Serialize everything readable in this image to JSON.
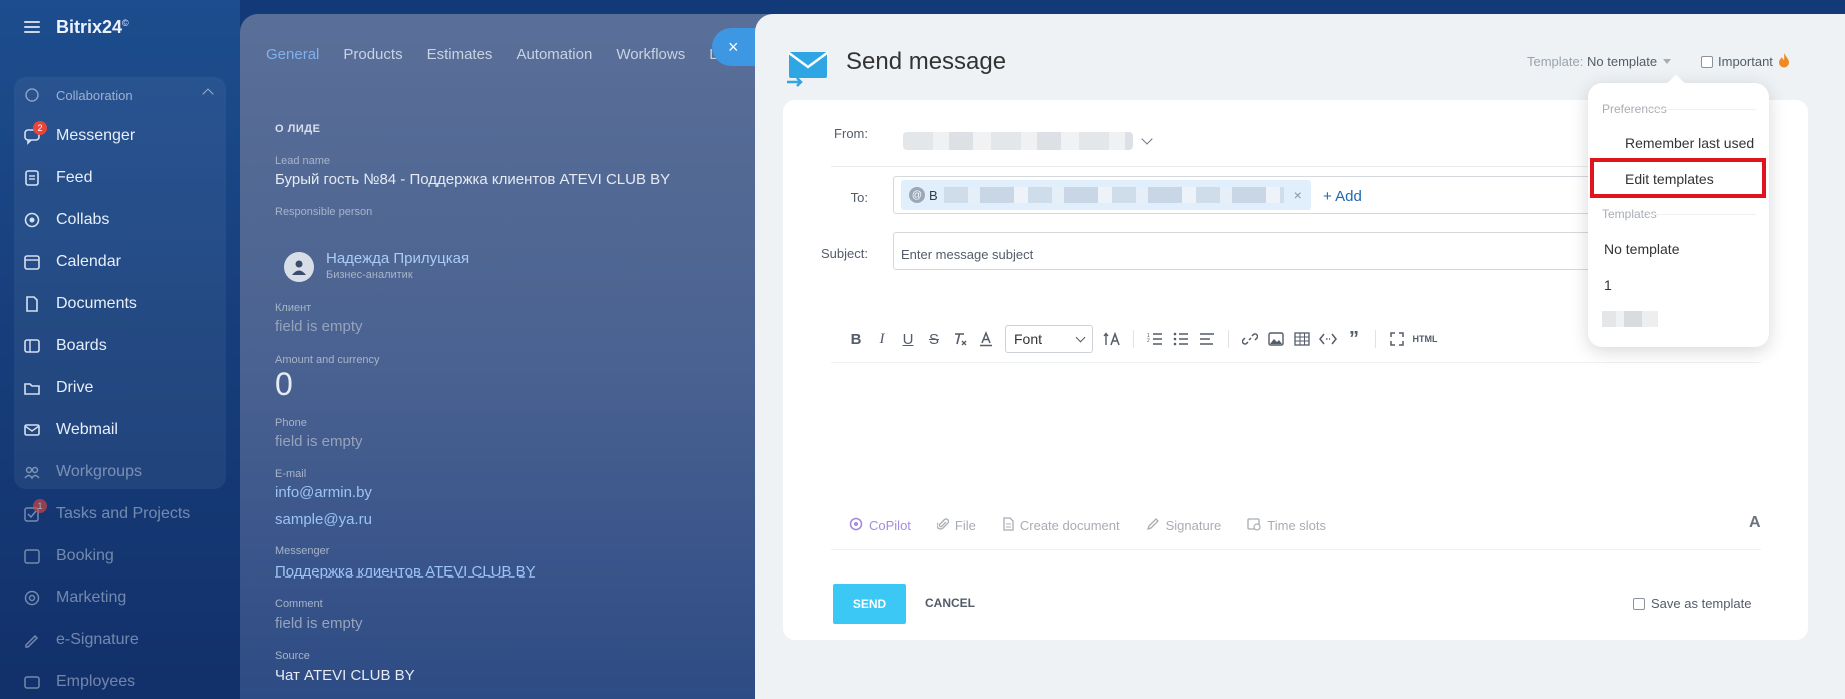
{
  "sidebar": {
    "logo": "Bitrix24",
    "logo_mark": "©",
    "group_label": "Collaboration",
    "items": [
      {
        "label": "Messenger",
        "icon": "chat-icon",
        "badge": "2"
      },
      {
        "label": "Feed",
        "icon": "feed-icon"
      },
      {
        "label": "Collabs",
        "icon": "collabs-icon"
      },
      {
        "label": "Calendar",
        "icon": "calendar-icon"
      },
      {
        "label": "Documents",
        "icon": "documents-icon"
      },
      {
        "label": "Boards",
        "icon": "boards-icon"
      },
      {
        "label": "Drive",
        "icon": "drive-icon"
      },
      {
        "label": "Webmail",
        "icon": "mail-icon"
      },
      {
        "label": "Workgroups",
        "icon": "workgroups-icon"
      },
      {
        "label": "Tasks and Projects",
        "icon": "tasks-icon",
        "badge": "1"
      },
      {
        "label": "Booking",
        "icon": "booking-icon"
      },
      {
        "label": "Marketing",
        "icon": "marketing-icon"
      },
      {
        "label": "e-Signature",
        "icon": "signature-icon"
      },
      {
        "label": "Employees",
        "icon": "employees-icon"
      }
    ]
  },
  "lead": {
    "tabs": [
      "General",
      "Products",
      "Estimates",
      "Automation",
      "Workflows",
      "L"
    ],
    "section_title": "О ЛИДЕ",
    "lead_name_label": "Lead name",
    "lead_name": "Бурый гость №84 - Поддержка клиентов ATEVI CLUB BY",
    "responsible_label": "Responsible person",
    "person_name": "Надежда Прилуцкая",
    "person_role": "Бизнес-аналитик",
    "client_label": "Клиент",
    "client_value": "field is empty",
    "amount_label": "Amount and currency",
    "amount_value": "0",
    "phone_label": "Phone",
    "phone_value": "field is empty",
    "email_label": "E-mail",
    "email_1": "info@armin.by",
    "email_2": "sample@ya.ru",
    "messenger_label": "Messenger",
    "messenger_value": "Поддержка клиентов ATEVI CLUB BY",
    "comment_label": "Comment",
    "comment_value": "field is empty",
    "source_label": "Source",
    "source_value": "Чат ATEVI CLUB BY"
  },
  "composer": {
    "title": "Send message",
    "template_label": "Template:",
    "template_value": "No template",
    "important_label": "Important",
    "from_label": "From:",
    "to_label": "To:",
    "recipient_initial": "B",
    "add_label": "+ Add",
    "subject_label": "Subject:",
    "subject_placeholder": "Enter message subject",
    "font_select": "Font",
    "html_label": "HTML",
    "attachments": {
      "copilot": "CoPilot",
      "file": "File",
      "create_document": "Create document",
      "signature": "Signature",
      "time_slots": "Time slots"
    },
    "font_toggle": "A",
    "send_label": "SEND",
    "cancel_label": "CANCEL",
    "save_template_label": "Save as template"
  },
  "template_menu": {
    "preferences_label": "Preferences",
    "remember_last": "Remember last used",
    "edit_templates": "Edit templates",
    "templates_label": "Templates",
    "no_template": "No template",
    "template_1": "1"
  },
  "colors": {
    "accent": "#3bc8f5",
    "link": "#2067b0",
    "highlight": "#e0141c"
  }
}
